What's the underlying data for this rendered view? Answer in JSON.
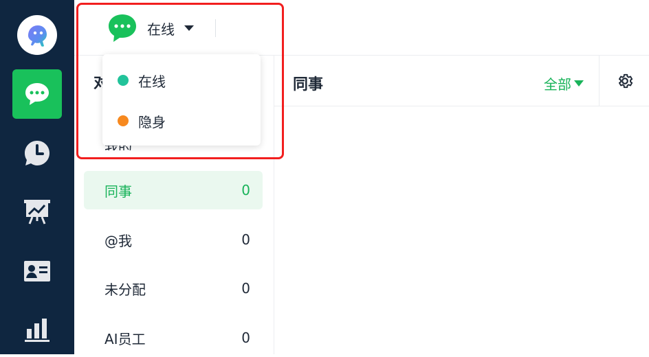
{
  "status": {
    "current_label": "在线",
    "options": [
      {
        "label": "在线",
        "color": "#22c39a"
      },
      {
        "label": "隐身",
        "color": "#f7891f"
      }
    ]
  },
  "list": {
    "title_partial": "对",
    "hidden_row_label_partial": "我的",
    "rows": [
      {
        "label": "同事",
        "count": "0",
        "active": true
      },
      {
        "label": "@我",
        "count": "0",
        "active": false
      },
      {
        "label": "未分配",
        "count": "0",
        "active": false
      },
      {
        "label": "AI员工",
        "count": "0",
        "active": false
      }
    ]
  },
  "content": {
    "title": "同事",
    "filter_label": "全部"
  },
  "colors": {
    "brand_green": "#19c15b",
    "nav_bg": "#0f2640",
    "highlight_red": "#f21e1e"
  },
  "icons": [
    "logo-icon",
    "chat-icon",
    "clock-icon",
    "presentation-chart-icon",
    "contact-card-icon",
    "bar-chart-icon",
    "status-chat-icon",
    "settings-gear-icon"
  ]
}
